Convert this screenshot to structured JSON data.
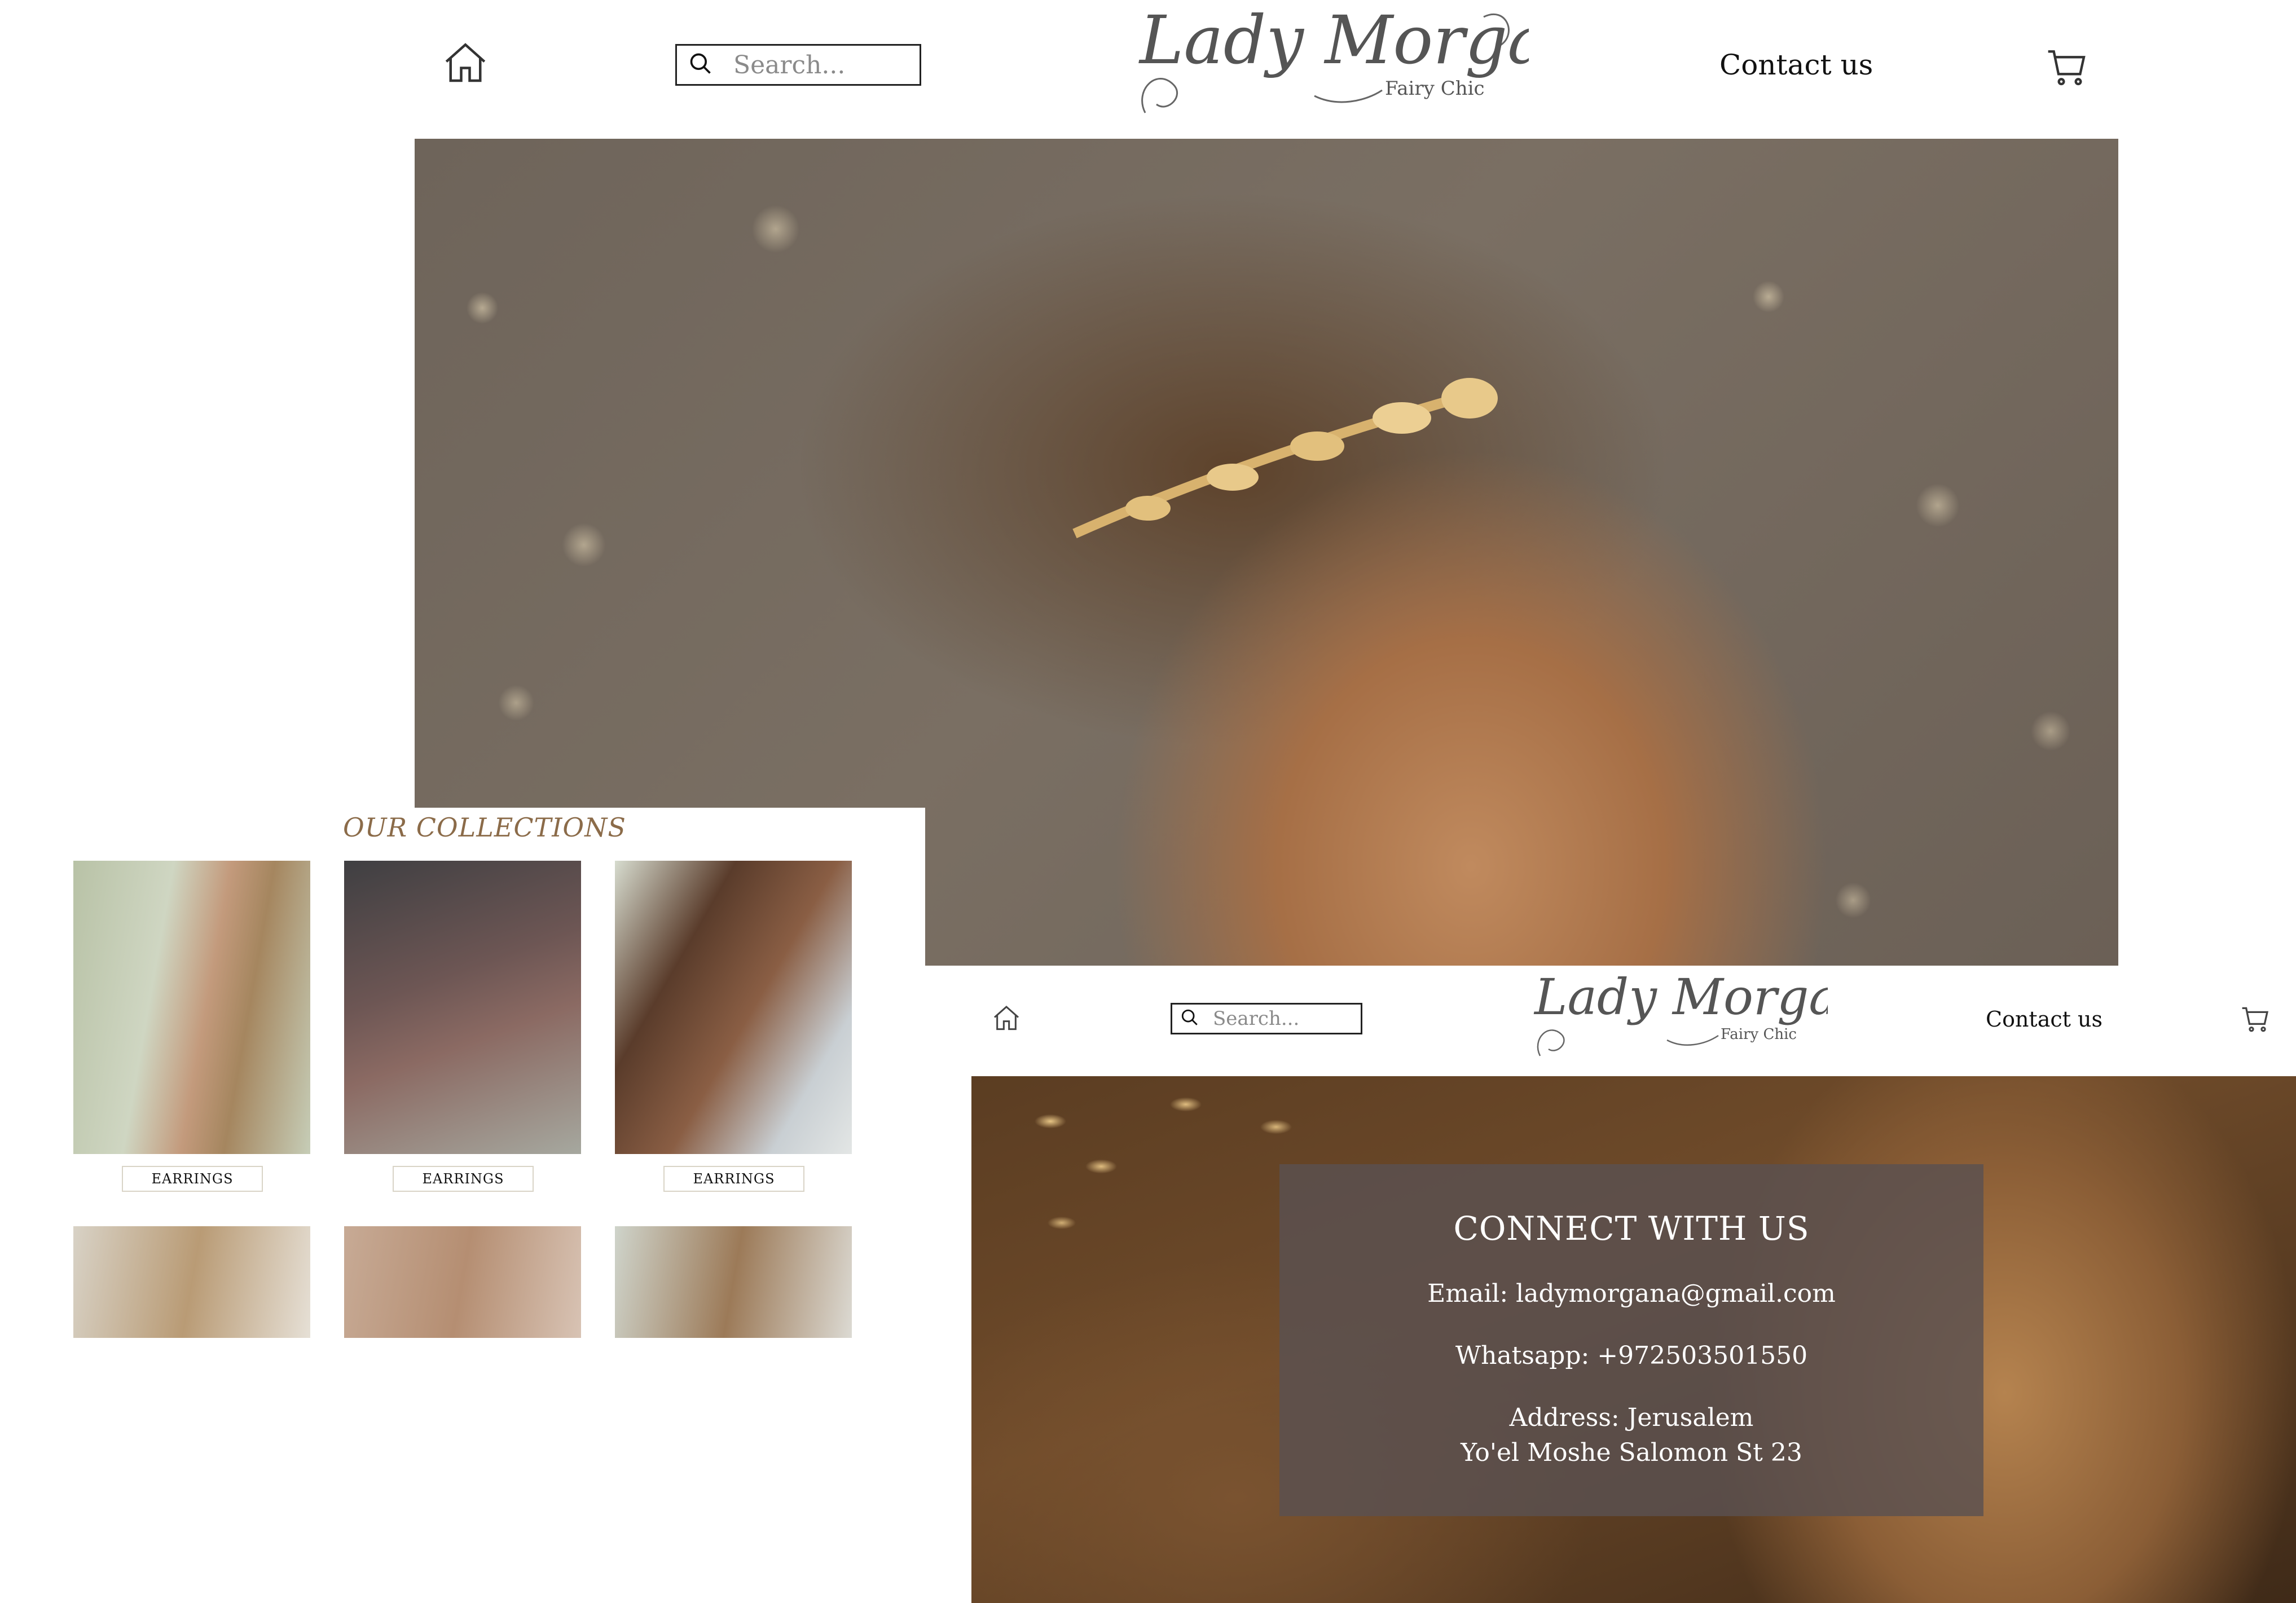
{
  "header": {
    "search_placeholder": "Search...",
    "logo_main": "Lady Morgana",
    "logo_sub": "Fairy Chic",
    "contact_label": "Contact us"
  },
  "collections": {
    "title": "OUR COLLECTIONS",
    "items": [
      {
        "label": "EARRINGS"
      },
      {
        "label": "EARRINGS"
      },
      {
        "label": "EARRINGS"
      }
    ]
  },
  "contact": {
    "title": "CONNECT WITH US",
    "email": "Email: ladymorgana@gmail.com",
    "whatsapp": "Whatsapp: +972503501550",
    "address_line1": "Address: Jerusalem",
    "address_line2": "Yo'el Moshe Salomon St 23"
  },
  "icons": {
    "home": "home-icon",
    "search": "search-icon",
    "cart": "cart-icon"
  },
  "colors": {
    "collections_title": "#8b6b49",
    "contact_card": "#5a5050",
    "background": "#ffffff"
  }
}
